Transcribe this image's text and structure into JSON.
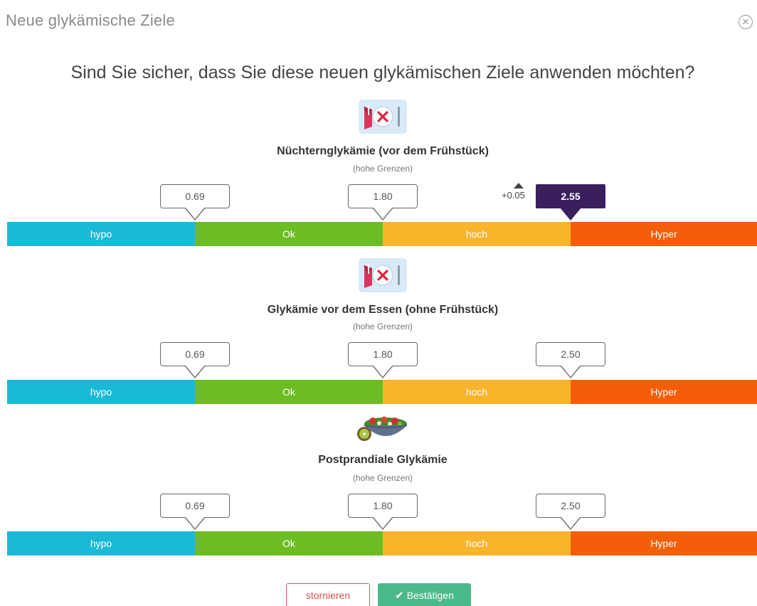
{
  "dialog": {
    "title": "Neue glykämische Ziele",
    "question": "Sind Sie sicher, dass Sie diese neuen glykämischen Ziele anwenden möchten?",
    "close_icon": "close-circle-icon"
  },
  "sections": [
    {
      "icon": "empty-plate-icon",
      "title": "Nüchternglykämie (vor dem Frühstück)",
      "subtitle": "(hohe Grenzen)",
      "markers": [
        "0.69",
        "1.80",
        "2.55"
      ],
      "changed_marker_index": 2,
      "delta": "+0.05",
      "zones": [
        "hypo",
        "Ok",
        "hoch",
        "Hyper"
      ]
    },
    {
      "icon": "empty-plate-icon",
      "title": "Glykämie vor dem Essen (ohne Frühstück)",
      "subtitle": "(hohe Grenzen)",
      "markers": [
        "0.69",
        "1.80",
        "2.50"
      ],
      "zones": [
        "hypo",
        "Ok",
        "hoch",
        "Hyper"
      ]
    },
    {
      "icon": "salad-bowl-icon",
      "title": "Postprandiale Glykämie",
      "subtitle": "(hohe Grenzen)",
      "markers": [
        "0.69",
        "1.80",
        "2.50"
      ],
      "zones": [
        "hypo",
        "Ok",
        "hoch",
        "Hyper"
      ]
    }
  ],
  "buttons": {
    "cancel": "stornieren",
    "confirm": "Bestätigen",
    "confirm_icon": "checkmark-icon"
  },
  "colors": {
    "hypo": "#1ab9d6",
    "ok": "#6cbd23",
    "hoch": "#f8b52b",
    "hyper": "#f55e09",
    "changed_marker": "#3a1f5d",
    "confirm": "#4cb98a",
    "cancel": "#d9534f"
  }
}
